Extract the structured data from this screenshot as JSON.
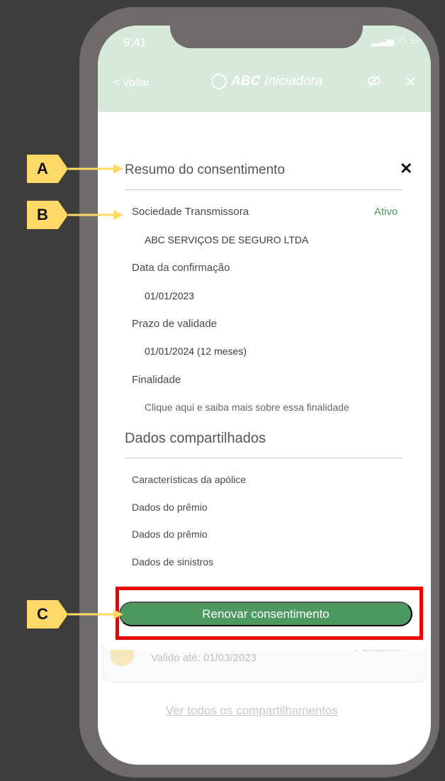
{
  "status_bar": {
    "time": "9:41",
    "icons": "▂▃▅ ◠ ▭"
  },
  "nav": {
    "back": "< Voltar",
    "brand_bold": "ABC",
    "brand_light": "Iniciadora",
    "eye_icon": "eye-slash-icon",
    "close_icon": "×"
  },
  "modal": {
    "title": "Resumo do consentimento",
    "close": "✕",
    "institution_label": "Sociedade Transmissora",
    "status": "Ativo",
    "institution_name": "ABC SERVIÇOS DE SEGURO LTDA",
    "confirmation_label": "Data da confirmação",
    "confirmation_date": "01/01/2023",
    "validity_label": "Prazo de validade",
    "validity_value": "01/01/2024 (12 meses)",
    "purpose_label": "Finalidade",
    "purpose_link": "Clique aqui e saiba mais sobre essa finalidade",
    "shared_title": "Dados compartilhados",
    "shared_items": [
      "Características da apólice",
      "Dados do prêmio",
      "Dados do prêmio",
      "Dados de sinistros"
    ],
    "renew_button": "Renovar consentimento"
  },
  "background": {
    "valid_until": "Valido até: 01/03/2023",
    "pending": "Pendente >",
    "see_all": "Ver todos os compartilhamentos"
  },
  "annotations": {
    "a": "A",
    "b": "B",
    "c": "C"
  },
  "colors": {
    "accent_green": "#4e9962",
    "active_green": "#4e9a5e",
    "highlight_red": "#ee0000",
    "tag_yellow": "#ffd966",
    "header_green": "#d7e9da"
  }
}
